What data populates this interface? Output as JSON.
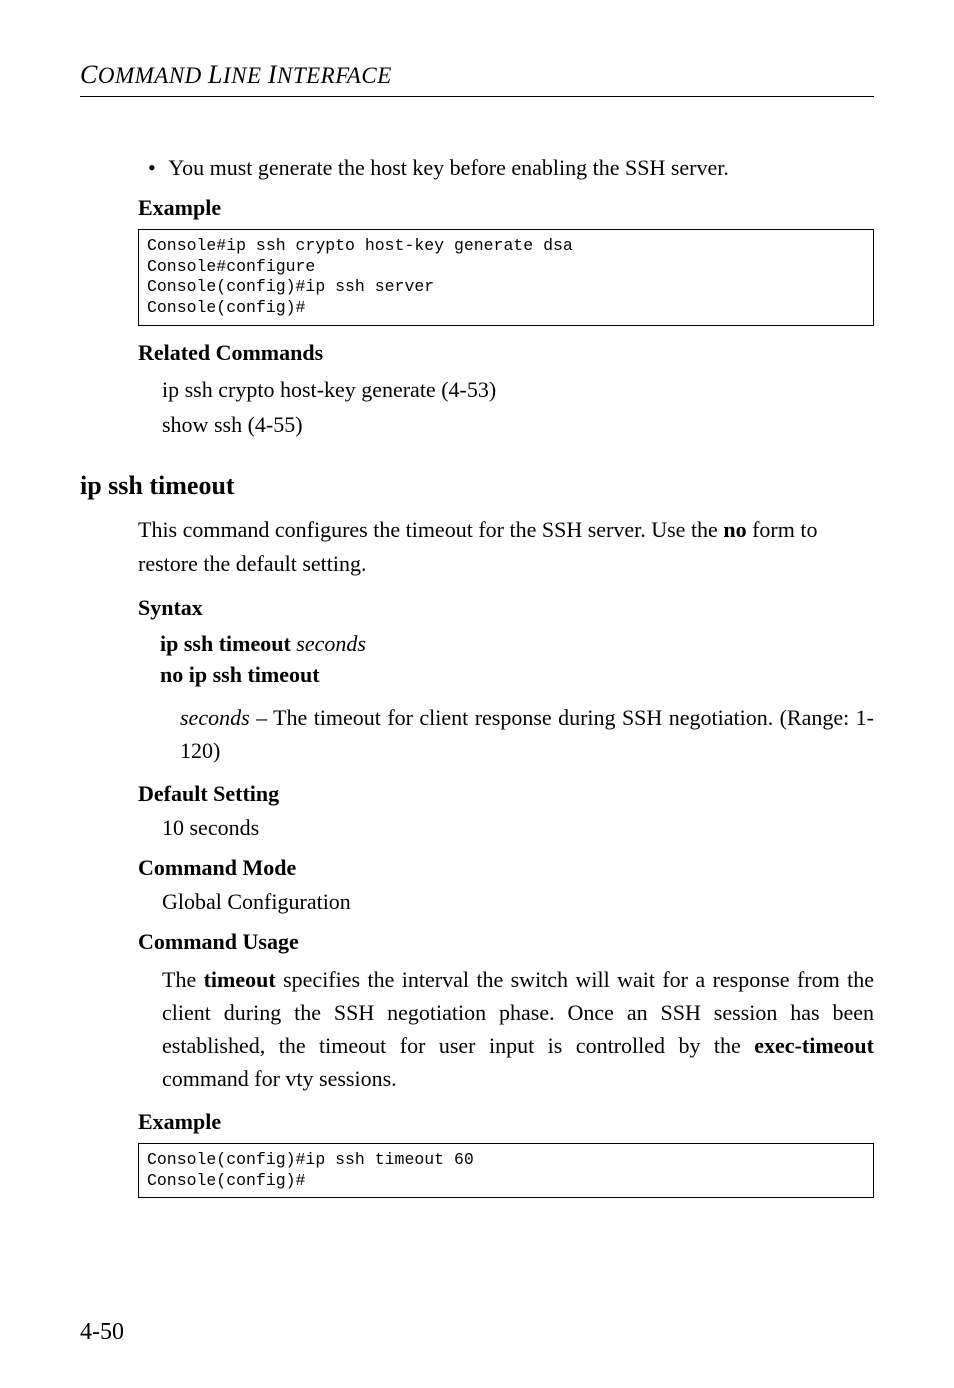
{
  "running_header": "COMMAND LINE INTERFACE",
  "bullet1": "You must generate the host key before enabling the SSH server.",
  "example_label": "Example",
  "code_block1": "Console#ip ssh crypto host-key generate dsa\nConsole#configure\nConsole(config)#ip ssh server\nConsole(config)#",
  "related_commands_label": "Related Commands",
  "related_commands": {
    "line1": "ip ssh crypto host-key generate (4-53)",
    "line2": "show ssh (4-55)"
  },
  "heading": "ip ssh timeout",
  "intro_para_pre": "This command configures the timeout for the SSH server. Use the ",
  "intro_para_bold": "no",
  "intro_para_post": " form to restore the default setting.",
  "syntax_label": "Syntax",
  "syntax_line1_bold": "ip ssh timeout",
  "syntax_line1_italic": " seconds",
  "syntax_line2_bold": "no ip ssh timeout",
  "syntax_desc_italic": "seconds",
  "syntax_desc_rest": " – The timeout for client response during SSH negotiation. (Range: 1-120)",
  "default_setting_label": "Default Setting",
  "default_setting_value": "10 seconds",
  "command_mode_label": "Command Mode",
  "command_mode_value": "Global Configuration",
  "command_usage_label": "Command Usage",
  "usage_pre": "The ",
  "usage_bold1": "timeout",
  "usage_mid": " specifies the interval the switch will wait for a response from the client during the SSH negotiation phase. Once an SSH session has been established, the timeout for user input is controlled by the ",
  "usage_bold2": "exec-timeout",
  "usage_post": " command for vty sessions.",
  "example2_label": "Example",
  "code_block2": "Console(config)#ip ssh timeout 60\nConsole(config)#",
  "page_number": "4-50"
}
